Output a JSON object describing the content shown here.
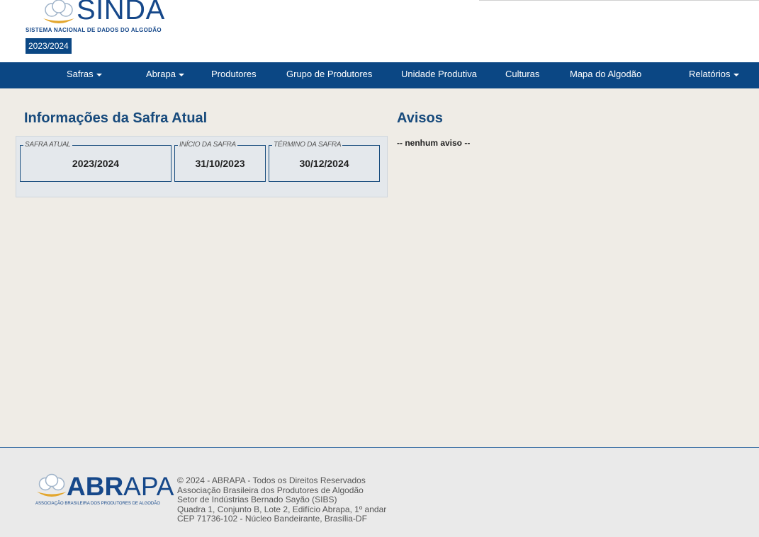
{
  "header": {
    "logo_word": "SINDA",
    "logo_subtitle": "SISTEMA NACIONAL DE DADOS DO ALGODÃO",
    "season_badge": "2023/2024"
  },
  "nav": {
    "items": [
      {
        "label": "Safras",
        "has_dropdown": true
      },
      {
        "label": "Abrapa",
        "has_dropdown": true
      },
      {
        "label": "Produtores",
        "has_dropdown": false
      },
      {
        "label": "Grupo de Produtores",
        "has_dropdown": false
      },
      {
        "label": "Unidade Produtiva",
        "has_dropdown": false
      },
      {
        "label": "Culturas",
        "has_dropdown": false
      },
      {
        "label": "Mapa do Algodão",
        "has_dropdown": false
      },
      {
        "label": "Relatórios",
        "has_dropdown": true
      }
    ]
  },
  "current_season": {
    "title": "Informações da Safra Atual",
    "fields": [
      {
        "legend": "SAFRA ATUAL",
        "value": "2023/2024"
      },
      {
        "legend": "INÍCIO DA SAFRA",
        "value": "31/10/2023"
      },
      {
        "legend": "TÉRMINO DA SAFRA",
        "value": "30/12/2024"
      }
    ]
  },
  "notices": {
    "title": "Avisos",
    "empty_text": "-- nenhum aviso --"
  },
  "footer": {
    "logo_word_bold": "ABR",
    "logo_word_rest": "APA",
    "logo_subtitle": "ASSOCIAÇÃO BRASILEIRA DOS PRODUTORES DE ALGODÃO",
    "lines": [
      "© 2024 - ABRAPA - Todos os Direitos Reservados",
      "Associação Brasileira dos Produtores de Algodão",
      "Setor de Indústrias Bernado Sayão (SIBS)",
      "Quadra 1, Conjunto B, Lote 2, Edifício Abrapa, 1º andar",
      "CEP 71736-102 - Núcleo Bandeirante, Brasília-DF"
    ]
  },
  "colors": {
    "primary": "#0b4784",
    "title": "#174a7c",
    "background": "#efece6"
  }
}
